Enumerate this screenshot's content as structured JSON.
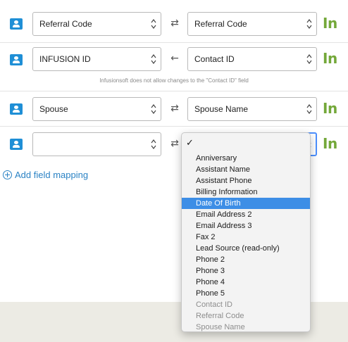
{
  "colors": {
    "accent_blue": "#1f8fd6",
    "link_blue": "#2a82c4",
    "infusion_green": "#74a83a",
    "highlight": "#3d8ee6"
  },
  "rows": [
    {
      "left_value": "Referral Code",
      "direction_icon": "bidirectional-arrows-icon",
      "direction_glyph": "⇄",
      "right_value": "Referral Code",
      "logo": "In"
    },
    {
      "left_value": "INFUSION ID",
      "direction_icon": "left-arrow-icon",
      "direction_glyph": "←",
      "right_value": "Contact ID",
      "logo": "In"
    },
    {
      "left_value": "Spouse",
      "direction_icon": "bidirectional-arrows-icon",
      "direction_glyph": "⇄",
      "right_value": "Spouse Name",
      "logo": "In"
    },
    {
      "left_value": "",
      "direction_icon": "bidirectional-arrows-icon",
      "direction_glyph": "⇄",
      "right_value": "",
      "logo": "In"
    }
  ],
  "note": "Infusionsoft does not allow changes to the \"Contact ID\" field",
  "add_mapping_label": "Add field mapping",
  "dropdown": {
    "check_glyph": "✓",
    "items": [
      {
        "label": "Anniversary",
        "state": "normal"
      },
      {
        "label": "Assistant Name",
        "state": "normal"
      },
      {
        "label": "Assistant Phone",
        "state": "normal"
      },
      {
        "label": "Billing Information",
        "state": "normal"
      },
      {
        "label": "Date Of Birth",
        "state": "highlight"
      },
      {
        "label": "Email Address 2",
        "state": "normal"
      },
      {
        "label": "Email Address 3",
        "state": "normal"
      },
      {
        "label": "Fax 2",
        "state": "normal"
      },
      {
        "label": "Lead Source (read-only)",
        "state": "normal"
      },
      {
        "label": "Phone 2",
        "state": "normal"
      },
      {
        "label": "Phone 3",
        "state": "normal"
      },
      {
        "label": "Phone 4",
        "state": "normal"
      },
      {
        "label": "Phone 5",
        "state": "normal"
      },
      {
        "label": "Contact ID",
        "state": "disabled"
      },
      {
        "label": "Referral Code",
        "state": "disabled"
      },
      {
        "label": "Spouse Name",
        "state": "disabled"
      }
    ]
  }
}
